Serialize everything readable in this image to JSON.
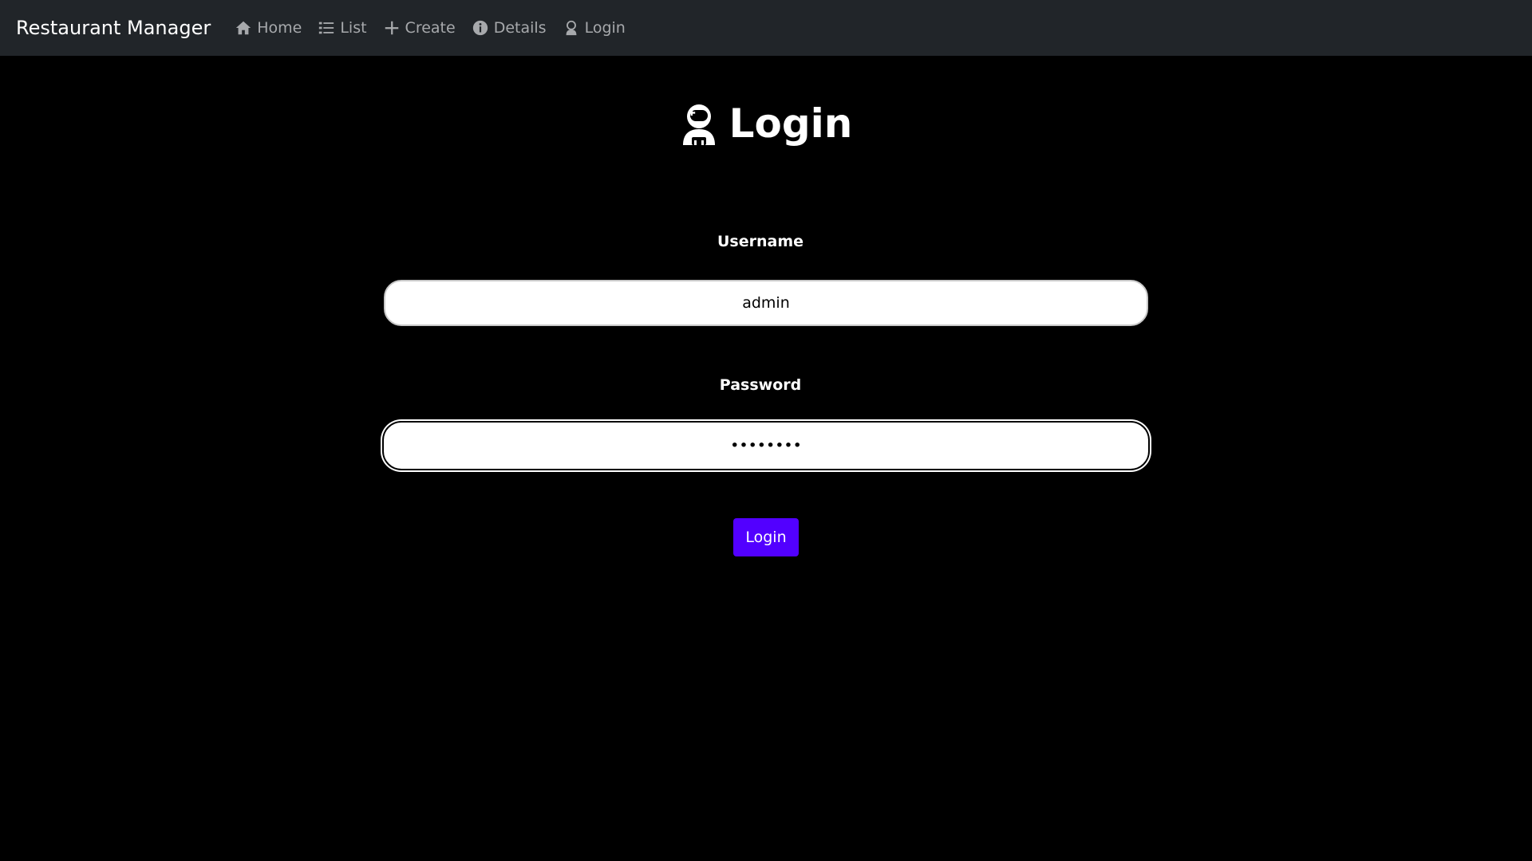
{
  "navbar": {
    "brand": "Restaurant Manager",
    "links": [
      {
        "label": "Home",
        "icon": "house-icon"
      },
      {
        "label": "List",
        "icon": "list-icon"
      },
      {
        "label": "Create",
        "icon": "plus-icon"
      },
      {
        "label": "Details",
        "icon": "info-circle-icon"
      },
      {
        "label": "Login",
        "icon": "user-astronaut-icon"
      }
    ],
    "background": "#212529",
    "link_color": "#a7a9ac"
  },
  "page": {
    "title": "Login",
    "title_icon": "user-astronaut-icon",
    "background": "#000000"
  },
  "form": {
    "username_label": "Username",
    "username_value": "admin",
    "password_label": "Password",
    "password_value": "password",
    "submit_label": "Login",
    "submit_color": "#5200ff"
  }
}
